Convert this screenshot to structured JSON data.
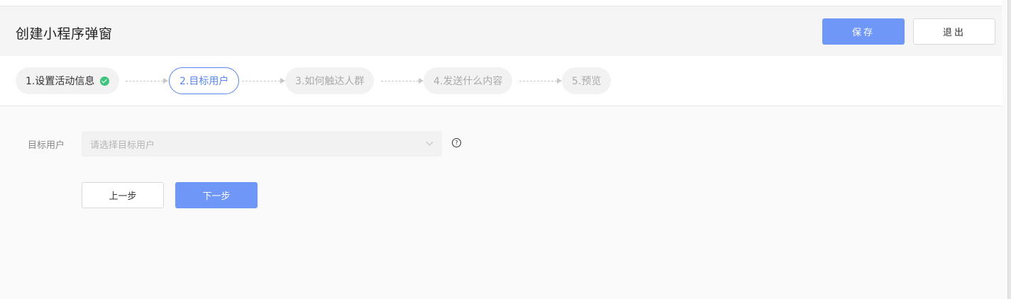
{
  "header": {
    "title": "创建小程序弹窗",
    "save_label": "保存",
    "exit_label": "退出"
  },
  "steps": [
    {
      "label": "1.设置活动信息",
      "status": "done"
    },
    {
      "label": "2.目标用户",
      "status": "active"
    },
    {
      "label": "3.如何触达人群",
      "status": "pending"
    },
    {
      "label": "4.发送什么内容",
      "status": "pending"
    },
    {
      "label": "5.预览",
      "status": "pending"
    }
  ],
  "form": {
    "target_user_label": "目标用户",
    "target_user_placeholder": "请选择目标用户",
    "help_icon": "question-circle-icon"
  },
  "actions": {
    "prev_label": "上一步",
    "next_label": "下一步"
  },
  "colors": {
    "primary": "#6f97f8",
    "active_step": "#5b86f0",
    "success": "#3fc37e"
  }
}
